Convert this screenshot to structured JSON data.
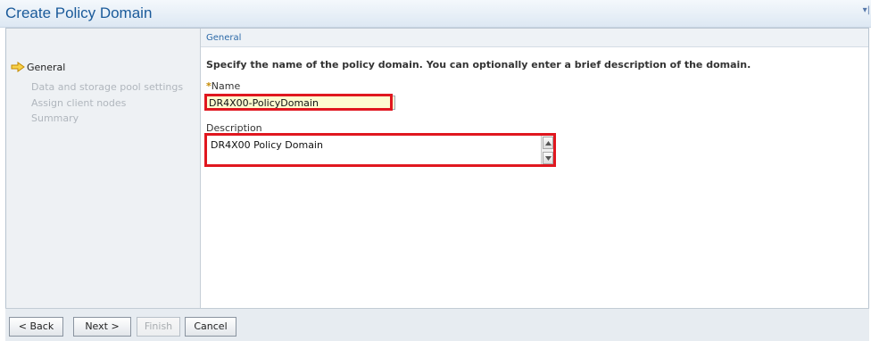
{
  "window": {
    "title": "Create Policy Domain",
    "menu_glyph": "▾|"
  },
  "nav": {
    "items": [
      {
        "label": "General",
        "current": true
      },
      {
        "label": "Data and storage pool settings",
        "current": false
      },
      {
        "label": "Assign client nodes",
        "current": false
      },
      {
        "label": "Summary",
        "current": false
      }
    ]
  },
  "content": {
    "breadcrumb": "General",
    "instructions": "Specify the name of the policy domain. You can optionally enter a brief description of the domain.",
    "name_required_mark": "*",
    "name_label": "Name",
    "name_value": "DR4X00-PolicyDomain",
    "description_label": "Description",
    "description_value": "DR4X00 Policy Domain"
  },
  "footer": {
    "back_label": "< Back",
    "next_label": "Next >",
    "finish_label": "Finish",
    "cancel_label": "Cancel"
  },
  "colors": {
    "title": "#1a5a9a",
    "highlight": "#e0171f",
    "name_field_bg": "#fdfbd0",
    "nav_arrow": "#e7a800"
  },
  "icons": {
    "nav_current": "arrow-right-icon"
  }
}
